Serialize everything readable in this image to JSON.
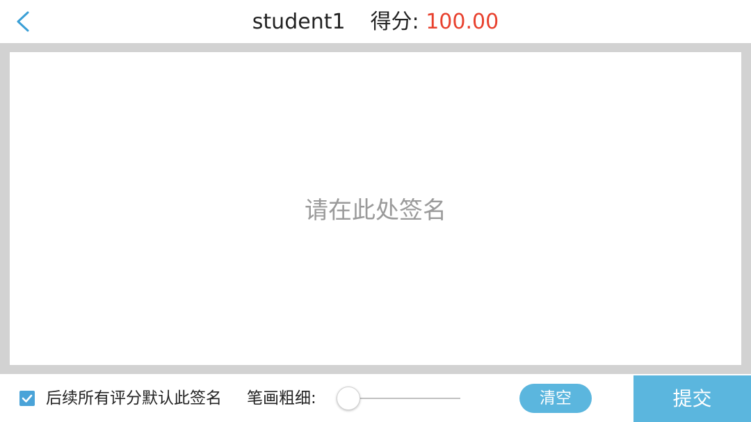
{
  "header": {
    "back_icon": "chevron-left-icon",
    "student_name": "student1",
    "score_label": "得分:",
    "score_value": "100.00"
  },
  "signature_pad": {
    "placeholder": "请在此处签名"
  },
  "footer": {
    "default_signature_checked": true,
    "default_signature_label": "后续所有评分默认此签名",
    "stroke_width_label": "笔画粗细:",
    "stroke_width_level": 0,
    "clear_label": "清空",
    "submit_label": "提交"
  },
  "colors": {
    "accent": "#5bb6de",
    "score": "#e8412e",
    "frame": "#d2d2d2",
    "checkbox": "#4aa3d8"
  }
}
